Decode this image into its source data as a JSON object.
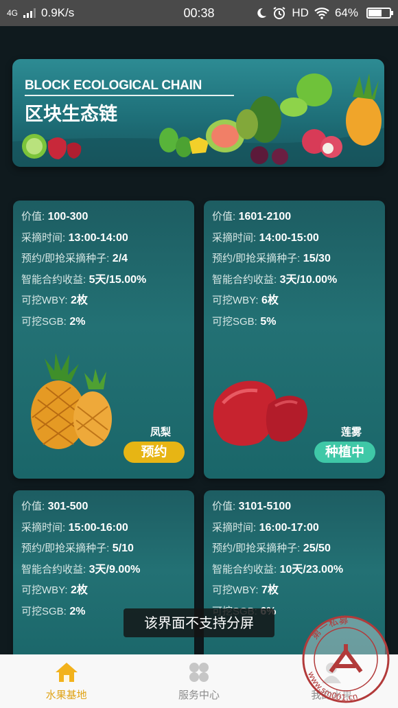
{
  "status_bar": {
    "network": "4G",
    "speed": "0.9K/s",
    "time": "00:38",
    "hd": "HD",
    "battery": "64%",
    "battery_level": 0.64
  },
  "banner": {
    "title_en": "BLOCK ECOLOGICAL CHAIN",
    "title_cn": "区块生态链"
  },
  "cards": [
    {
      "value_label": "价值:",
      "value": "100-300",
      "pick_time_label": "采摘时间:",
      "pick_time": "13:00-14:00",
      "seeds_label": "预约/即抢采摘种子:",
      "seeds": "2/4",
      "contract_label": "智能合约收益:",
      "contract": "5天/15.00%",
      "wby_label": "可挖WBY:",
      "wby": "2枚",
      "sgb_label": "可挖SGB:",
      "sgb": "2%",
      "fruit_name": "凤梨",
      "action": "预约",
      "action_color": "#e7b514"
    },
    {
      "value_label": "价值:",
      "value": "1601-2100",
      "pick_time_label": "采摘时间:",
      "pick_time": "14:00-15:00",
      "seeds_label": "预约/即抢采摘种子:",
      "seeds": "15/30",
      "contract_label": "智能合约收益:",
      "contract": "3天/10.00%",
      "wby_label": "可挖WBY:",
      "wby": "6枚",
      "sgb_label": "可挖SGB:",
      "sgb": "5%",
      "fruit_name": "莲雾",
      "action": "种植中",
      "action_color": "#3fc8a7"
    },
    {
      "value_label": "价值:",
      "value": "301-500",
      "pick_time_label": "采摘时间:",
      "pick_time": "15:00-16:00",
      "seeds_label": "预约/即抢采摘种子:",
      "seeds": "5/10",
      "contract_label": "智能合约收益:",
      "contract": "3天/9.00%",
      "wby_label": "可挖WBY:",
      "wby": "2枚",
      "sgb_label": "可挖SGB:",
      "sgb": "2%"
    },
    {
      "value_label": "价值:",
      "value": "3101-5100",
      "pick_time_label": "采摘时间:",
      "pick_time": "16:00-17:00",
      "seeds_label": "预约/即抢采摘种子:",
      "seeds": "25/50",
      "contract_label": "智能合约收益:",
      "contract": "10天/23.00%",
      "wby_label": "可挖WBY:",
      "wby": "7枚",
      "sgb_label": "可挖SGB:",
      "sgb": "6%"
    }
  ],
  "toast": "该界面不支持分屏",
  "bottom_nav": [
    {
      "label": "水果基地",
      "icon": "home-icon",
      "active": true
    },
    {
      "label": "服务中心",
      "icon": "grid-icon",
      "active": false
    },
    {
      "label": "我的水果",
      "icon": "user-icon",
      "active": false
    }
  ],
  "watermark": {
    "text_top": "第一私募",
    "text_bottom": "www.sm001.cn"
  },
  "colors": {
    "background": "#0f1a1e",
    "card": "#237174",
    "accent_active": "#e0a418",
    "reserve": "#e7b514",
    "planting": "#3fc8a7"
  }
}
